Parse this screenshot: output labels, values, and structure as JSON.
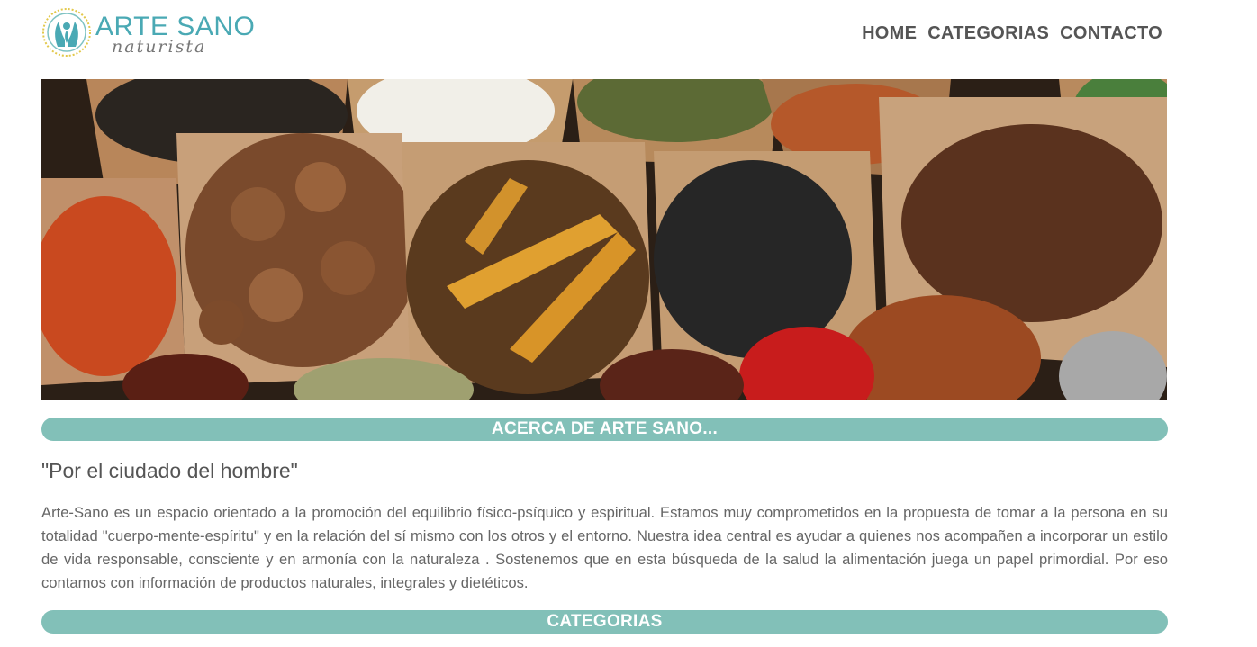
{
  "brand": {
    "name": "ARTE SANO",
    "tagline": "naturista",
    "colors": {
      "primary": "#4aa9b4",
      "accent_bar": "#82c0b8",
      "text": "#555555"
    }
  },
  "nav": {
    "items": [
      {
        "label": "HOME"
      },
      {
        "label": "CATEGORIAS"
      },
      {
        "label": "CONTACTO"
      }
    ]
  },
  "banner": {
    "icon": "spices-photo"
  },
  "about": {
    "heading": "ACERCA DE ARTE SANO...",
    "quote": "\"Por el ciudado del hombre\"",
    "body": "Arte-Sano es un espacio orientado a la promoción del equilibrio físico-psíquico y espiritual. Estamos muy comprometidos en la propuesta de tomar a la persona en su totalidad \"cuerpo-mente-espíritu\" y en la relación del sí mismo con los otros y el entorno. Nuestra idea central es ayudar a quienes nos acompañen a incorporar un estilo de vida responsable, consciente y en armonía con la naturaleza . Sostenemos que en esta búsqueda de la salud la alimentación juega un papel primordial. Por eso contamos con información de productos naturales, integrales y dietéticos."
  },
  "categories": {
    "heading": "CATEGORIAS"
  }
}
